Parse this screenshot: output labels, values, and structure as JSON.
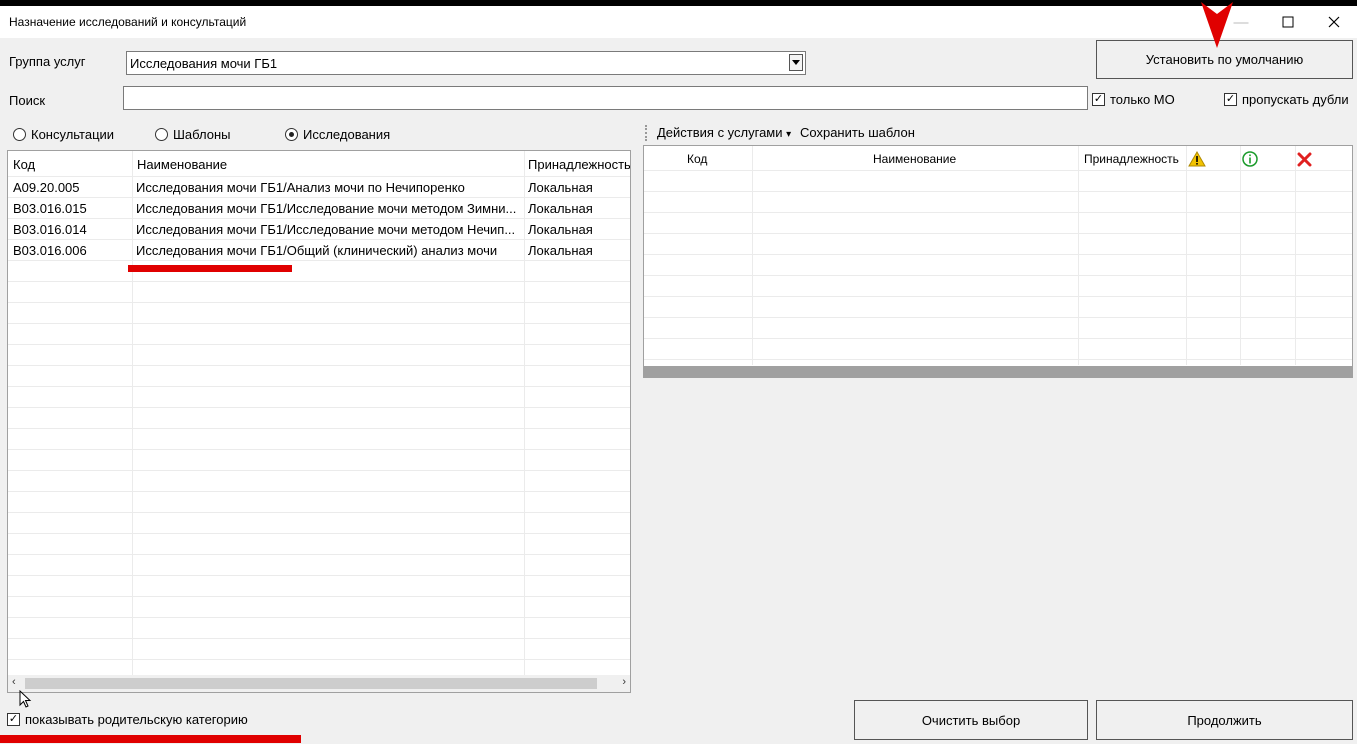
{
  "window": {
    "title": "Назначение исследований и консультаций",
    "minimize_symbol": "—",
    "maximize_symbol": "☐",
    "close_symbol": "✕"
  },
  "form": {
    "group_label": "Группа услуг",
    "group_value": "Исследования мочи ГБ1",
    "search_label": "Поиск",
    "search_value": "",
    "set_default_label": "Установить по умолчанию",
    "only_mo_label": "только МО",
    "only_mo_checked": true,
    "skip_duplicates_label": "пропускать дубли",
    "skip_duplicates_checked": true
  },
  "radios": [
    {
      "label": "Консультации",
      "selected": false
    },
    {
      "label": "Шаблоны",
      "selected": false
    },
    {
      "label": "Исследования",
      "selected": true
    }
  ],
  "left_table": {
    "columns": [
      "Код",
      "Наименование",
      "Принадлежность"
    ],
    "rows": [
      {
        "code": "A09.20.005",
        "name": "Исследования мочи ГБ1/Анализ мочи по Нечипоренко",
        "owner": "Локальная"
      },
      {
        "code": "B03.016.015",
        "name": "Исследования мочи ГБ1/Исследование мочи методом Зимни...",
        "owner": "Локальная"
      },
      {
        "code": "B03.016.014",
        "name": "Исследования мочи ГБ1/Исследование мочи методом Нечип...",
        "owner": "Локальная"
      },
      {
        "code": "B03.016.006",
        "name": "Исследования мочи ГБ1/Общий (клинический) анализ мочи",
        "owner": "Локальная"
      }
    ]
  },
  "right_toolbar": {
    "actions_label": "Действия с услугами",
    "actions_arrow": "▾",
    "save_template_label": "Сохранить шаблон"
  },
  "right_table": {
    "columns": [
      "Код",
      "Наименование",
      "Принадлежность"
    ],
    "icon_columns": [
      "warning-icon",
      "info-icon",
      "delete-icon"
    ],
    "colors": {
      "warning": "#f2c200",
      "info": "#1a9a2a",
      "delete": "#e02020"
    }
  },
  "footer": {
    "show_parent_label": "показывать родительскую категорию",
    "show_parent_checked": true,
    "clear_label": "Очистить выбор",
    "continue_label": "Продолжить"
  },
  "colors": {
    "annotation_red": "#e00000"
  }
}
